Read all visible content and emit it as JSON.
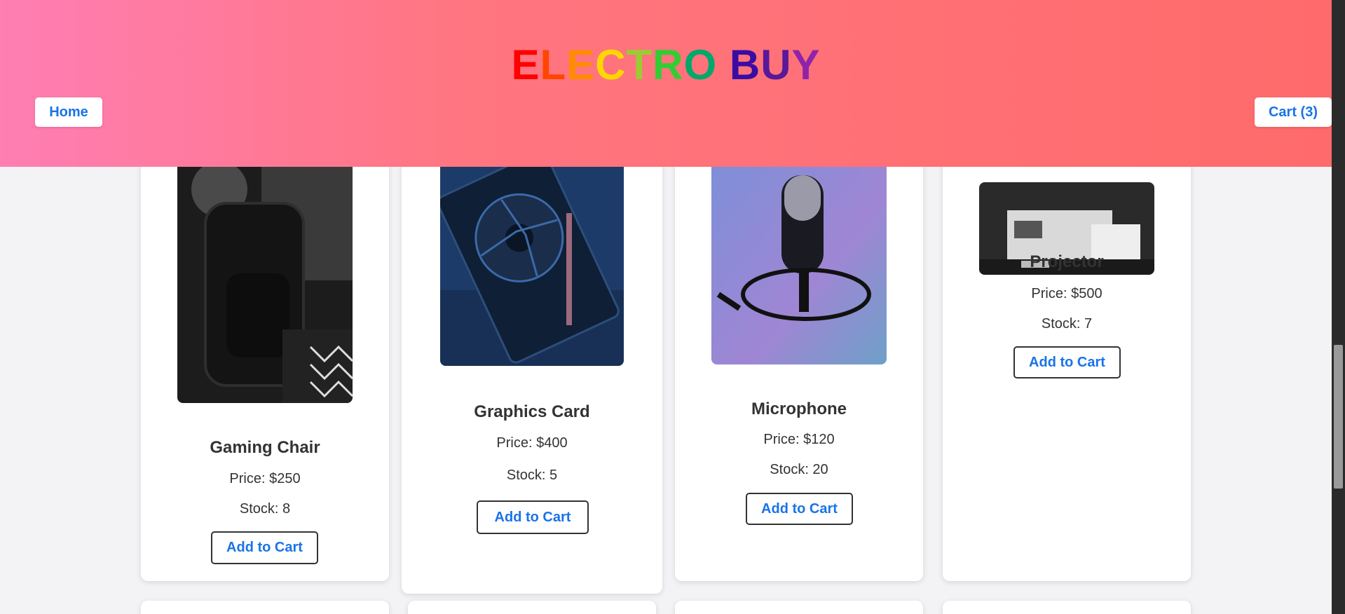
{
  "header": {
    "logo_letters": [
      "E",
      "L",
      "E",
      "C",
      "T",
      "R",
      "O",
      " ",
      "B",
      "U",
      "Y"
    ],
    "logo_colors": [
      "#ff0000",
      "#ff4500",
      "#ff8c00",
      "#ffd700",
      "#9acd32",
      "#32cd32",
      "#00a86b",
      "#ffffff",
      "#3a0ca3",
      "#5a189a",
      "#8e24aa"
    ],
    "home_label": "Home",
    "cart_label": "Cart (3)"
  },
  "products": [
    {
      "name": "Gaming Chair",
      "price": "Price: $250",
      "stock": "Stock: 8",
      "button": "Add to Cart",
      "image_icon": "gaming-chair-photo"
    },
    {
      "name": "Graphics Card",
      "price": "Price: $400",
      "stock": "Stock: 5",
      "button": "Add to Cart",
      "image_icon": "graphics-card-photo"
    },
    {
      "name": "Microphone",
      "price": "Price: $120",
      "stock": "Stock: 20",
      "button": "Add to Cart",
      "image_icon": "microphone-photo"
    },
    {
      "name": "Projector",
      "price": "Price: $500",
      "stock": "Stock: 7",
      "button": "Add to Cart",
      "image_icon": "projector-photo"
    }
  ],
  "colors": {
    "button_text": "#1a73e8",
    "header_gradient_start": "#ff7eb3",
    "header_gradient_end": "#ff6b6b"
  }
}
